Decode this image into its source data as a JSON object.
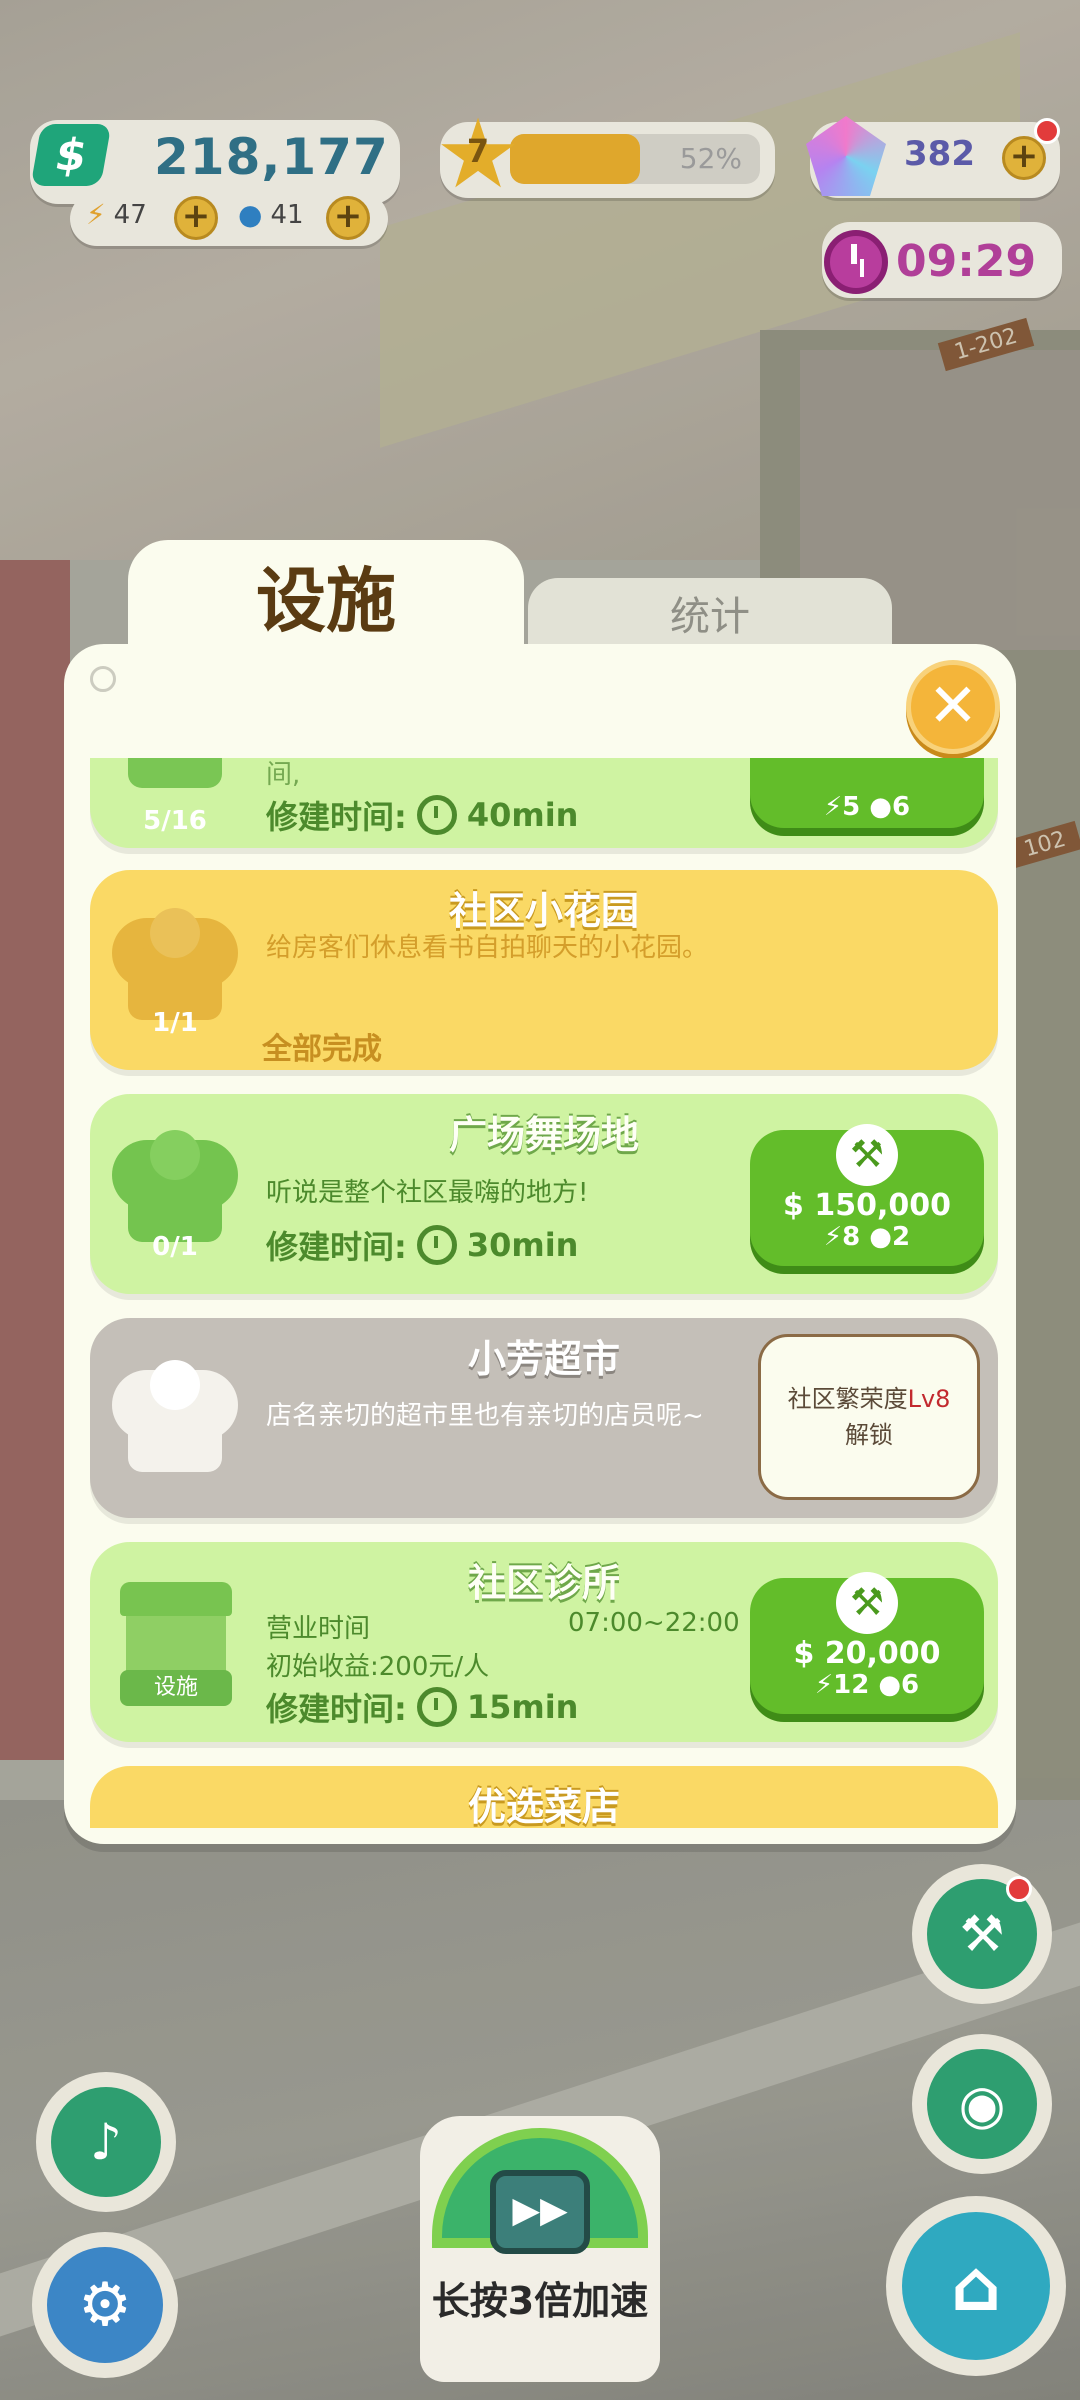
{
  "hud": {
    "money": "218,177",
    "energy": "47",
    "water": "41",
    "level": "7",
    "xp_percent_label": "52%",
    "xp_percent": 52,
    "gems": "382",
    "timer": "09:29"
  },
  "scene": {
    "room_label_1": "1-202",
    "room_label_2": "102"
  },
  "dialog": {
    "tab_facilities": "设施",
    "tab_stats": "统计",
    "close_label": "✕"
  },
  "cards": {
    "partial": {
      "count": "5/16",
      "desc": "间,",
      "build_time_label": "修建时间:",
      "build_time": "40min",
      "cost_money": "",
      "cost_energy": "5",
      "cost_water": "6"
    },
    "garden": {
      "title": "社区小花园",
      "desc": "给房客们休息看书自拍聊天的小花园。",
      "count": "1/1",
      "status": "全部完成"
    },
    "dance": {
      "title": "广场舞场地",
      "desc": "听说是整个社区最嗨的地方!",
      "count": "0/1",
      "build_time_label": "修建时间:",
      "build_time": "30min",
      "cost_money": "150,000",
      "cost_energy": "8",
      "cost_water": "2"
    },
    "market": {
      "title": "小芳超市",
      "desc": "店名亲切的超市里也有亲切的店员呢~",
      "lock_line1": "社区繁荣度",
      "lock_level": "Lv8",
      "lock_line2": "解锁"
    },
    "clinic": {
      "title": "社区诊所",
      "hours_label": "营业时间",
      "hours": "07:00~22:00",
      "income": "初始收益:200元/人",
      "icon_tag": "设施",
      "build_time_label": "修建时间:",
      "build_time": "15min",
      "cost_money": "20,000",
      "cost_energy": "12",
      "cost_water": "6"
    },
    "veggie": {
      "title": "优选菜店"
    }
  },
  "controls": {
    "speed_label": "长按3倍加速"
  }
}
